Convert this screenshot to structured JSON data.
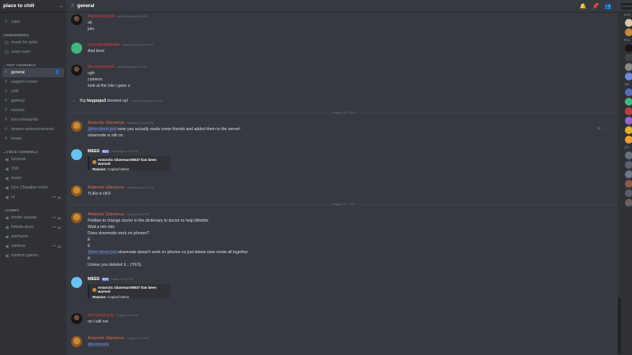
{
  "server": {
    "name": "place to chill"
  },
  "sidebar": {
    "top_channels": [
      {
        "label": "rules"
      }
    ],
    "categories": [
      {
        "name": "ADMINS/MODS",
        "channels": [
          {
            "label": "music for gods"
          },
          {
            "label": "court room"
          }
        ]
      },
      {
        "name": "TEXT CHANNELS",
        "channels": [
          {
            "label": "general"
          },
          {
            "label": "support-center"
          },
          {
            "label": "chill"
          },
          {
            "label": "gaming"
          },
          {
            "label": "memes"
          },
          {
            "label": "bot-commands"
          },
          {
            "label": "stream-announcements"
          },
          {
            "label": "music"
          }
        ]
      },
      {
        "name": "VOICE CHANNELS",
        "channels": [
          {
            "label": "General"
          },
          {
            "label": "chill"
          },
          {
            "label": "music"
          },
          {
            "label": "Don Cheadles room"
          },
          {
            "label": "vc",
            "count_a": "00",
            "count_b": "10"
          }
        ]
      },
      {
        "name": "GAMES",
        "channels": [
          {
            "label": "fornite squads",
            "count_a": "00",
            "count_b": "04"
          },
          {
            "label": "fortnite duos",
            "count_a": "00",
            "count_b": "02"
          },
          {
            "label": "warframe"
          },
          {
            "label": "rainbow",
            "count_a": "00",
            "count_b": "10"
          },
          {
            "label": "random games"
          }
        ]
      }
    ]
  },
  "header": {
    "channel": "general",
    "search_placeholder": "Search"
  },
  "messages": {
    "m1": {
      "author": "the blood god",
      "time": "Last Monday at 8:36 PM",
      "lines": [
        "ok",
        "join"
      ]
    },
    "m2": {
      "author": "yooodyeahbrade",
      "time": "Last Monday at 9:10 PM",
      "lines": [
        "And tired"
      ]
    },
    "m3": {
      "author": "the blood god",
      "time": "Last Monday at 9:10 PM",
      "lines": [
        "ugh",
        "comeon",
        "look at the role i gave u"
      ]
    },
    "sys1": {
      "prefix": "Big",
      "user": "heypops3",
      "suffix": "showed up!",
      "time": "Last Monday at 9:12 PM"
    },
    "div1": "August 14, 2019",
    "m4": {
      "author": "Antarctic Glavenus",
      "time": "Yesterday at 4:20 PM",
      "mention": "@the blood god",
      "line1_rest": " wow you actually made some friends and added them to the server!",
      "line2": "slowmode is still on"
    },
    "m5": {
      "author": "MEE6",
      "bot": "BOT",
      "time": "Yesterday at 4:21 PM",
      "embed_title": "Antarctic Glavenus#8037 has been warned",
      "reason_label": "Reason:",
      "reason": " Capital letters"
    },
    "m6": {
      "author": "Antarctic Glavenus",
      "time": "Yesterday at 4:21 PM",
      "lines": [
        "TURn it OFF"
      ]
    },
    "div2": "August 15, 2019",
    "m7": {
      "author": "Antarctic Glavenus",
      "time": "Today at 2:48 PM",
      "lines": [
        "Petition to change doctor in the dictionary to doctor to help littlebits",
        "Wait a min min",
        "Does slowmode work on phones?",
        "E",
        "E"
      ],
      "mention": "@the blood god",
      "mention_rest": " slowmode doesn't work on phones so just delete slow mode all together",
      "after": [
        "K",
        "Unless you deleted it... (YES)"
      ]
    },
    "m8": {
      "author": "MEE6",
      "bot": "BOT",
      "time": "Today at 2:51 PM",
      "embed_title": "Antarctic Glavenus#8037 has been warned",
      "reason_label": "Reason:",
      "reason": " Capital letters"
    },
    "m9": {
      "author": "the blood god",
      "time": "Today at 3:01 PM",
      "lines": [
        "no I will not"
      ]
    },
    "m10": {
      "author": "Antarctic Glavenus",
      "time": "Today at 3:33 PM",
      "mention": "@everyone"
    }
  },
  "members": {
    "heading_1": "MOD",
    "heading_2": "PEA",
    "heading_3": "ONL",
    "heading_4": "OFF"
  },
  "colors": {
    "accent": "#7289da",
    "danger": "#e03d3d",
    "online": "#43b581",
    "bg": "#36393f",
    "sidebar": "#2f3136"
  }
}
